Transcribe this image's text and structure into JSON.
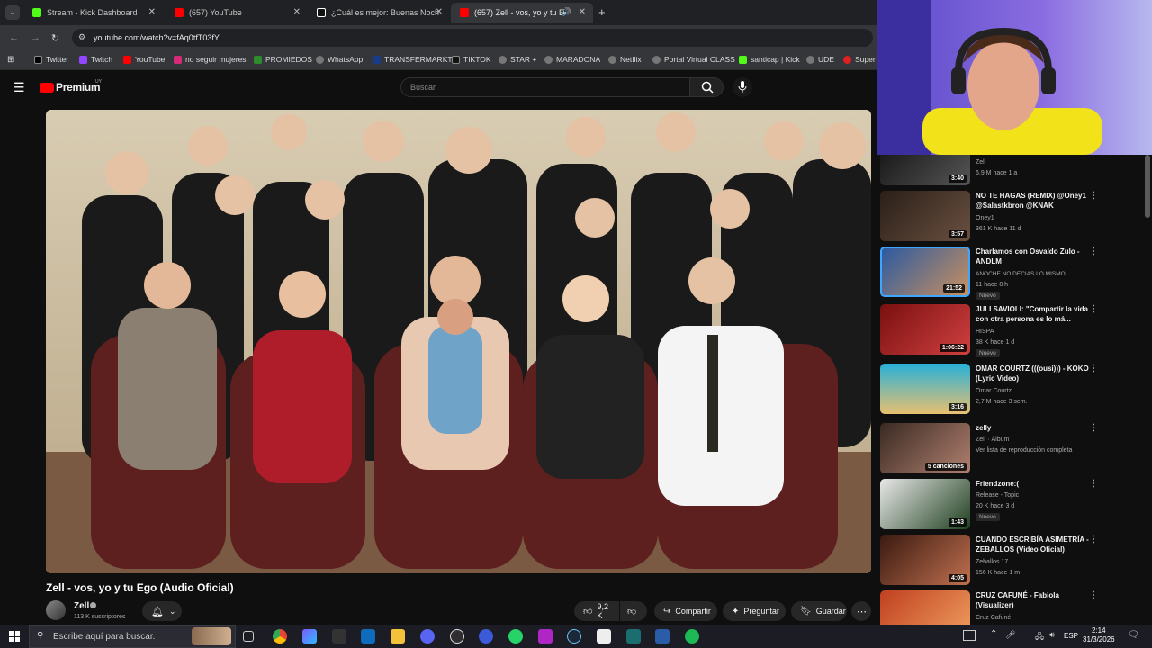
{
  "tabs": [
    {
      "label": "Stream - Kick Dashboard",
      "color": "#53fc18"
    },
    {
      "label": "(657) YouTube",
      "color": "#ff0000"
    },
    {
      "label": "¿Cuál es mejor: Buenas Noches",
      "color": "#ffffff"
    },
    {
      "label": "(657) Zell - vos, yo y tu Ego",
      "color": "#ff0000"
    }
  ],
  "new_tab": "+",
  "url": "youtube.com/watch?v=fAq0tfT03fY",
  "bookmarks": [
    "Twitter",
    "Twitch",
    "YouTube",
    "no seguir mujeres",
    "PROMIEDOS",
    "WhatsApp",
    "TRANSFERMARKT",
    "TIKTOK",
    "STAR +",
    "MARADONA",
    "Netflix",
    "Portal Virtual CLASS",
    "santicap | Kick",
    "UDE",
    "Super"
  ],
  "yt": {
    "logo": "Premium",
    "region": "UY",
    "search_placeholder": "Buscar"
  },
  "video": {
    "title": "Zell - vos, yo y tu Ego (Audio Oficial)",
    "channel": "Zell",
    "subscribers": "113 K suscriptores",
    "likes": "9,2 K",
    "share": "Compartir",
    "ask": "Preguntar",
    "save": "Guardar"
  },
  "sidebar": [
    {
      "title": "",
      "channel": "Zell",
      "stats": "6,9 M  hace 1 a",
      "duration": "3:40",
      "new": "",
      "colors": [
        "#222",
        "#555"
      ]
    },
    {
      "title": "NO TE HAGAS (REMIX) @Oney1 @Salastkbron @KNAK",
      "channel": "Oney1",
      "stats": "361 K  hace 11 d",
      "duration": "3:57",
      "new": "",
      "colors": [
        "#2a1f18",
        "#6a5040"
      ]
    },
    {
      "title": "Charlamos con Osvaldo Zulo - ANDLM",
      "channel": "ANOCHE NO DECIAS LO MISMO",
      "stats": "11  hace 8 h",
      "duration": "21:52",
      "new": "Nuevo",
      "colors": [
        "#2c5aa0",
        "#c89060"
      ]
    },
    {
      "title": "JULI SAVIOLI: \"Compartir la vida con otra persona es lo má...",
      "channel": "HISPA",
      "stats": "38 K  hace 1 d",
      "duration": "1:06:22",
      "new": "Nuevo",
      "colors": [
        "#7a1010",
        "#d04040"
      ]
    },
    {
      "title": "OMAR COURTZ (((ousi))) - KOKO (Lyric Video)",
      "channel": "Omar Courtz",
      "stats": "2,7 M  hace 3 sem.",
      "duration": "3:16",
      "new": "",
      "colors": [
        "#28b0d8",
        "#e8c070"
      ]
    },
    {
      "title": "zelly",
      "channel": "Zell · Álbum",
      "stats": "Ver lista de reproducción completa",
      "duration": "5 canciones",
      "new": "",
      "colors": [
        "#3a2a22",
        "#b08070"
      ]
    },
    {
      "title": "Friendzone:(",
      "channel": "Release - Topic",
      "stats": "20 K  hace 3 d",
      "duration": "1:43",
      "new": "Nuevo",
      "colors": [
        "#e8e8e8",
        "#204020"
      ]
    },
    {
      "title": "CUANDO ESCRIBÍA ASIMETRÍA - ZEBALLOS (Video Oficial)",
      "channel": "Zeballos 17",
      "stats": "156 K  hace 1 m",
      "duration": "4:05",
      "new": "",
      "colors": [
        "#3a1a10",
        "#c07050"
      ]
    },
    {
      "title": "CRUZ CAFUNÉ - Fabiola (Visualizer)",
      "channel": "Cruz Cafuné",
      "stats": "",
      "duration": "",
      "new": "",
      "colors": [
        "#c04020",
        "#f0a060"
      ]
    }
  ],
  "taskbar": {
    "search_placeholder": "Escribe aquí para buscar.",
    "lang": "ESP",
    "time": "2:14",
    "date": "31/3/2026"
  }
}
